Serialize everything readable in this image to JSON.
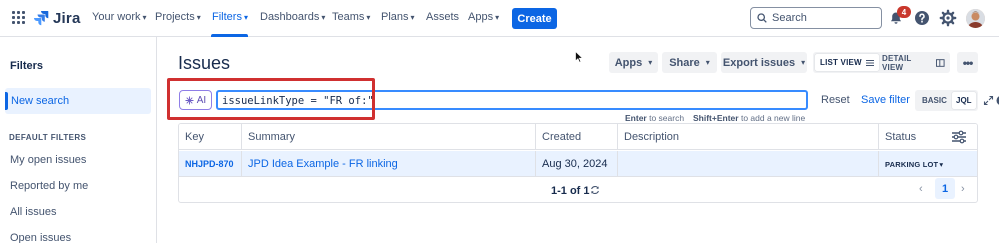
{
  "nav": {
    "logo": "Jira",
    "items": [
      {
        "label": "Your work",
        "dropdown": true
      },
      {
        "label": "Projects",
        "dropdown": true
      },
      {
        "label": "Filters",
        "dropdown": true,
        "active": true
      },
      {
        "label": "Dashboards",
        "dropdown": true
      },
      {
        "label": "Teams",
        "dropdown": true
      },
      {
        "label": "Plans",
        "dropdown": true
      },
      {
        "label": "Assets",
        "dropdown": false
      },
      {
        "label": "Apps",
        "dropdown": true
      }
    ],
    "create_label": "Create",
    "search_placeholder": "Search",
    "notification_count": "4",
    "icons": [
      "app-switcher-icon",
      "search-icon",
      "notification-bell-icon",
      "help-icon",
      "settings-icon"
    ]
  },
  "sidebar": {
    "title": "Filters",
    "new_search": "New search",
    "section_label": "DEFAULT FILTERS",
    "links": [
      "My open issues",
      "Reported by me",
      "All issues",
      "Open issues"
    ]
  },
  "main": {
    "title": "Issues",
    "toolbar": {
      "apps": "Apps",
      "share": "Share",
      "export": "Export issues",
      "list_view": "LIST VIEW",
      "detail_view": "DETAIL VIEW",
      "more": "•••"
    },
    "search": {
      "ai_label": "AI",
      "jql": "issueLinkType = \"FR of:\"",
      "reset": "Reset",
      "save_filter": "Save filter",
      "mode_basic": "BASIC",
      "mode_jql": "JQL",
      "mode_active": "JQL",
      "hint_key1": "Enter",
      "hint_text1": "to search",
      "hint_key2": "Shift+Enter",
      "hint_text2": "to add a new line"
    },
    "table": {
      "columns": [
        "Key",
        "Summary",
        "Created",
        "Description",
        "Status"
      ],
      "rows": [
        {
          "key": "NHJPD-870",
          "summary": "JPD Idea Example - FR linking",
          "created": "Aug 30, 2024",
          "description": "",
          "status": "PARKING LOT"
        }
      ],
      "pager_count": "1-1 of 1",
      "current_page": "1"
    }
  },
  "colors": {
    "brand": "#0c66e4",
    "highlight_frame": "#d03030",
    "selected_row": "#e9f2ff",
    "notification": "#c9372c",
    "ai_accent": "#8f7ee7"
  }
}
